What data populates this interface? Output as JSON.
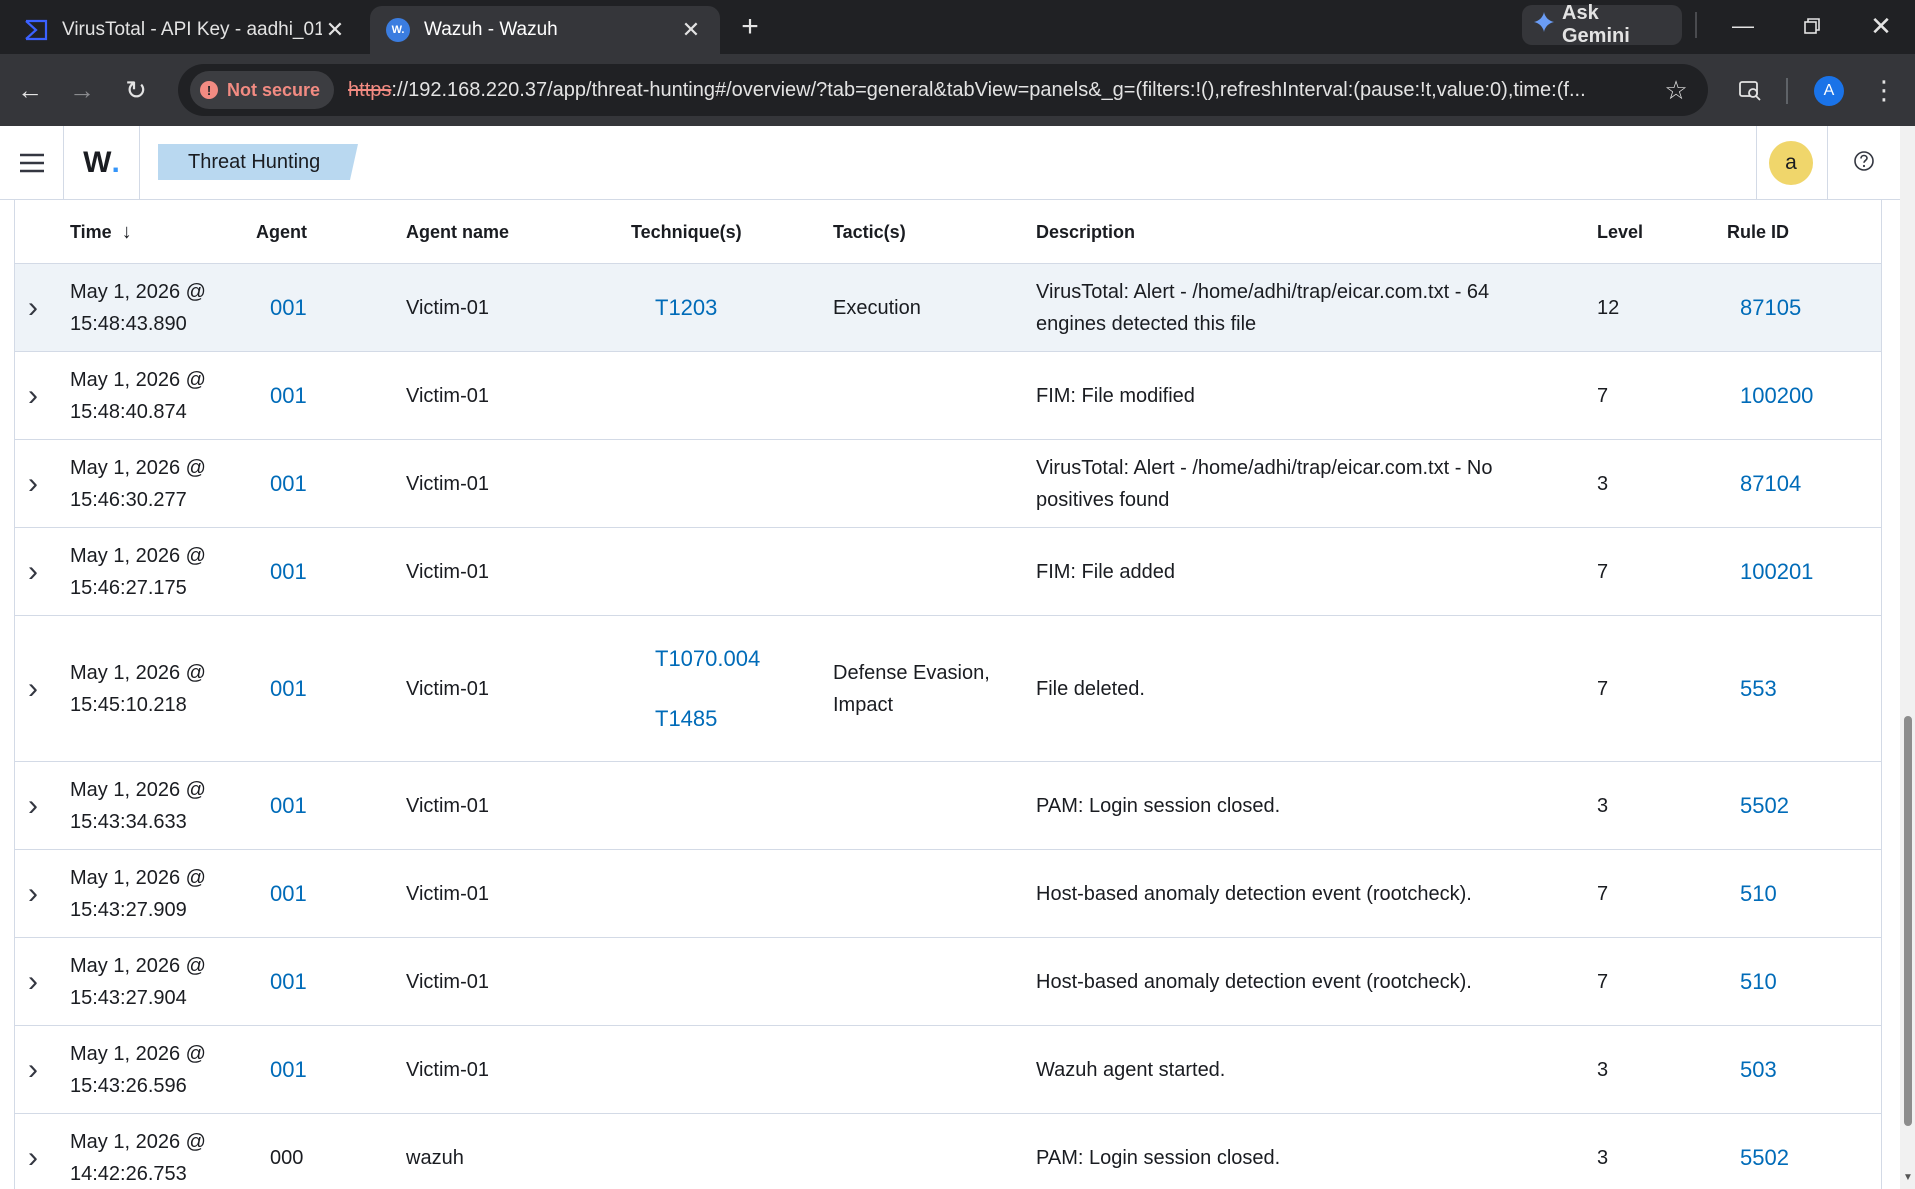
{
  "browser": {
    "tabs": [
      {
        "title": "VirusTotal - API Key - aadhi_01",
        "favicon": "virustotal-icon",
        "active": false
      },
      {
        "title": "Wazuh - Wazuh",
        "favicon": "wazuh-icon",
        "favicon_text": "W.",
        "active": true
      }
    ],
    "gemini_label": "Ask Gemini",
    "security_label": "Not secure",
    "url_scheme": "https",
    "url_rest": "://192.168.220.37/app/threat-hunting#/overview/?tab=general&tabView=panels&_g=(filters:!(),refreshInterval:(pause:!t,value:0),time:(f...",
    "profile_initial": "A"
  },
  "app": {
    "logo_letter": "W",
    "logo_dot": ".",
    "breadcrumb": "Threat Hunting",
    "avatar_initial": "a",
    "accent_color": "#006bb8"
  },
  "table": {
    "columns": {
      "time": "Time",
      "agent": "Agent",
      "agent_name": "Agent name",
      "techniques": "Technique(s)",
      "tactics": "Tactic(s)",
      "description": "Description",
      "level": "Level",
      "rule_id": "Rule ID"
    },
    "rows": [
      {
        "time_date": "May 1, 2026 @",
        "time_clock": "15:48:43.890",
        "agent": "001",
        "agent_link": true,
        "agent_name": "Victim-01",
        "techniques": [
          "T1203"
        ],
        "tactics": "Execution",
        "description": "VirusTotal: Alert - /home/adhi/trap/eicar.com.txt - 64 engines detected this file",
        "level": "12",
        "rule_id": "87105"
      },
      {
        "time_date": "May 1, 2026 @",
        "time_clock": "15:48:40.874",
        "agent": "001",
        "agent_link": true,
        "agent_name": "Victim-01",
        "techniques": [],
        "tactics": "",
        "description": "FIM: File modified",
        "level": "7",
        "rule_id": "100200"
      },
      {
        "time_date": "May 1, 2026 @",
        "time_clock": "15:46:30.277",
        "agent": "001",
        "agent_link": true,
        "agent_name": "Victim-01",
        "techniques": [],
        "tactics": "",
        "description": "VirusTotal: Alert - /home/adhi/trap/eicar.com.txt - No positives found",
        "level": "3",
        "rule_id": "87104"
      },
      {
        "time_date": "May 1, 2026 @",
        "time_clock": "15:46:27.175",
        "agent": "001",
        "agent_link": true,
        "agent_name": "Victim-01",
        "techniques": [],
        "tactics": "",
        "description": "FIM: File added",
        "level": "7",
        "rule_id": "100201"
      },
      {
        "time_date": "May 1, 2026 @",
        "time_clock": "15:45:10.218",
        "agent": "001",
        "agent_link": true,
        "agent_name": "Victim-01",
        "techniques": [
          "T1070.004",
          "T1485"
        ],
        "tactics": "Defense Evasion, Impact",
        "description": "File deleted.",
        "level": "7",
        "rule_id": "553"
      },
      {
        "time_date": "May 1, 2026 @",
        "time_clock": "15:43:34.633",
        "agent": "001",
        "agent_link": true,
        "agent_name": "Victim-01",
        "techniques": [],
        "tactics": "",
        "description": "PAM: Login session closed.",
        "level": "3",
        "rule_id": "5502"
      },
      {
        "time_date": "May 1, 2026 @",
        "time_clock": "15:43:27.909",
        "agent": "001",
        "agent_link": true,
        "agent_name": "Victim-01",
        "techniques": [],
        "tactics": "",
        "description": "Host-based anomaly detection event (rootcheck).",
        "level": "7",
        "rule_id": "510"
      },
      {
        "time_date": "May 1, 2026 @",
        "time_clock": "15:43:27.904",
        "agent": "001",
        "agent_link": true,
        "agent_name": "Victim-01",
        "techniques": [],
        "tactics": "",
        "description": "Host-based anomaly detection event (rootcheck).",
        "level": "7",
        "rule_id": "510"
      },
      {
        "time_date": "May 1, 2026 @",
        "time_clock": "15:43:26.596",
        "agent": "001",
        "agent_link": true,
        "agent_name": "Victim-01",
        "techniques": [],
        "tactics": "",
        "description": "Wazuh agent started.",
        "level": "3",
        "rule_id": "503"
      },
      {
        "time_date": "May 1, 2026 @",
        "time_clock": "14:42:26.753",
        "agent": "000",
        "agent_link": false,
        "agent_name": "wazuh",
        "techniques": [],
        "tactics": "",
        "description": "PAM: Login session closed.",
        "level": "3",
        "rule_id": "5502"
      }
    ]
  }
}
